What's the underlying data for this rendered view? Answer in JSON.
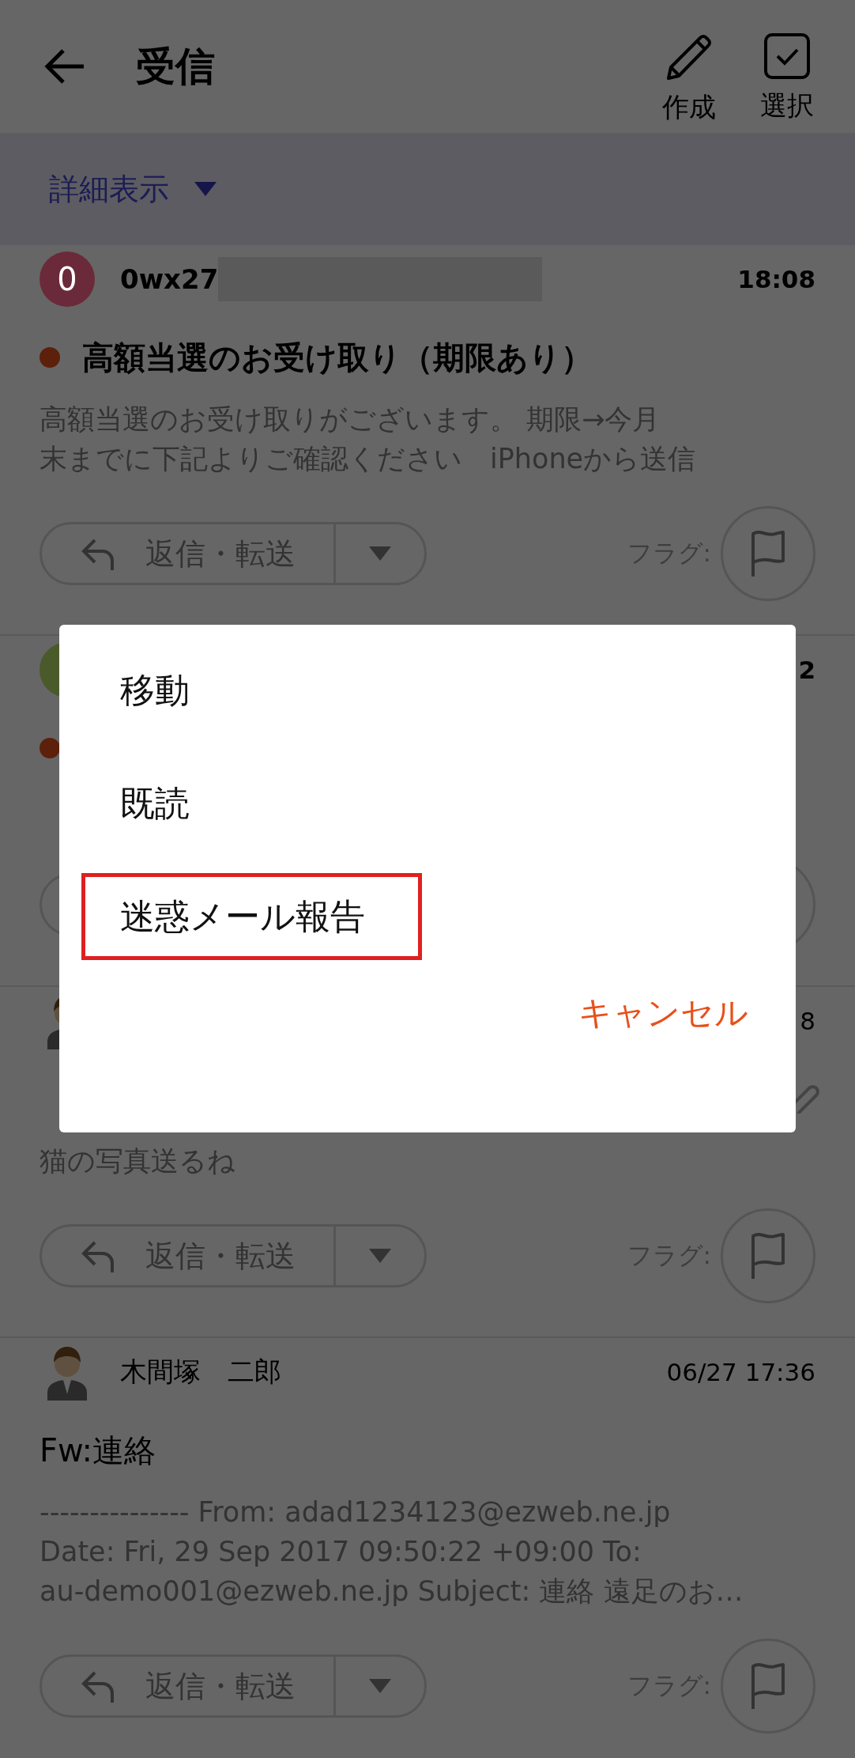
{
  "header": {
    "title": "受信",
    "actions": [
      {
        "kind": "compose",
        "label": "作成"
      },
      {
        "kind": "select",
        "label": "選択"
      }
    ]
  },
  "view_menu": {
    "label": "詳細表示"
  },
  "mails": [
    {
      "avatar": {
        "kind": "initial",
        "letter": "0",
        "color": "#6b2a3a"
      },
      "sender": "0wx27",
      "redacted": true,
      "time": "18:08",
      "unread": true,
      "subject": "高額当選のお受け取り（期限あり）",
      "preview_lines": [
        "高額当選のお受け取りがございます。 期限→今月",
        "末までに下記よりご確認ください　iPhoneから送信"
      ],
      "reply_label": "返信・転送",
      "flag_label": "フラグ:"
    },
    {
      "avatar": {
        "kind": "initial",
        "color": "#4a5a2a"
      },
      "time": "2",
      "unread": true
    },
    {
      "avatar": {
        "kind": "person"
      },
      "time": "8",
      "unread": false,
      "attachment": true,
      "preview_lines": [
        "猫の写真送るね"
      ],
      "reply_label": "返信・転送",
      "flag_label": "フラグ:"
    },
    {
      "avatar": {
        "kind": "person"
      },
      "sender": "木間塚　二郎",
      "time": "06/27 17:36",
      "unread": false,
      "subject": "Fw:連絡",
      "preview_lines": [
        "--------------- From: adad1234123@ezweb.ne.jp",
        "Date: Fri, 29 Sep 2017 09:50:22 +09:00 To:",
        "au-demo001@ezweb.ne.jp Subject: 連絡  遠足のお…"
      ],
      "reply_label": "返信・転送",
      "flag_label": "フラグ:"
    }
  ],
  "dialog": {
    "items": [
      {
        "label": "移動",
        "highlighted": false
      },
      {
        "label": "既読",
        "highlighted": false
      },
      {
        "label": "迷惑メール報告",
        "highlighted": true
      }
    ],
    "cancel": "キャンセル"
  }
}
